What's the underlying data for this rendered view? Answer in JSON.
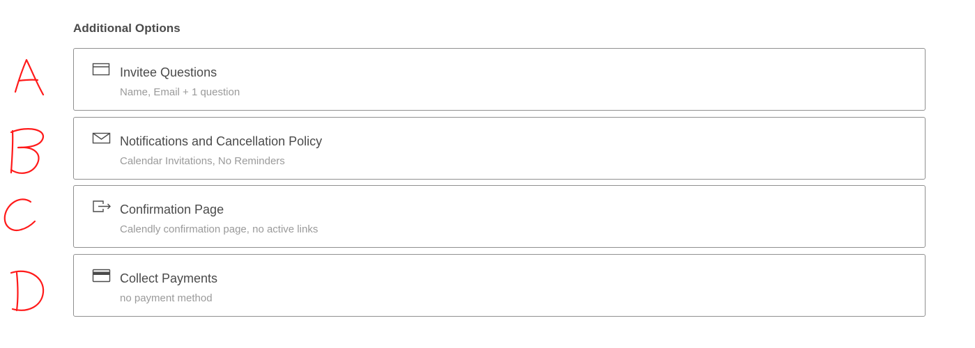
{
  "section": {
    "title": "Additional Options"
  },
  "options": [
    {
      "title": "Invitee Questions",
      "subtitle": "Name, Email + 1 question",
      "icon": "form-icon"
    },
    {
      "title": "Notifications and Cancellation Policy",
      "subtitle": "Calendar Invitations, No Reminders",
      "icon": "envelope-icon"
    },
    {
      "title": "Confirmation Page",
      "subtitle": "Calendly confirmation page, no active links",
      "icon": "redirect-icon"
    },
    {
      "title": "Collect Payments",
      "subtitle": "no payment method",
      "icon": "credit-card-icon"
    }
  ],
  "annotations": {
    "letters": [
      "A",
      "B",
      "C",
      "D"
    ],
    "color": "#ff1a1a"
  },
  "colors": {
    "border": "#8f8f8f",
    "title_text": "#4a4a4a",
    "subtitle_text": "#9a9a9a",
    "annotation": "#ff1a1a"
  }
}
